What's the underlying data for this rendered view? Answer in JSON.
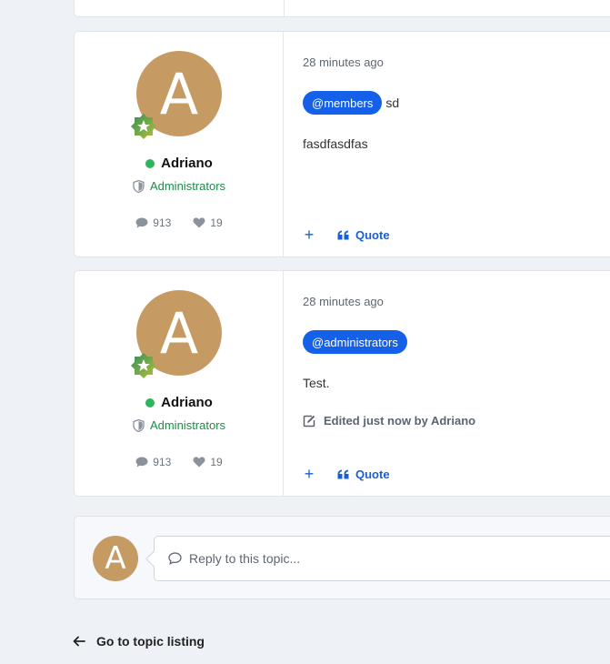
{
  "posts": [
    {
      "author": {
        "avatar_letter": "A",
        "name": "Adriano",
        "group": "Administrators",
        "post_count": "913",
        "reputation": "19"
      },
      "time": "28 minutes ago",
      "mention": "@members",
      "mention_trailing": "sd",
      "body": "fasdfasdfas",
      "quote_label": "Quote"
    },
    {
      "author": {
        "avatar_letter": "A",
        "name": "Adriano",
        "group": "Administrators",
        "post_count": "913",
        "reputation": "19"
      },
      "time": "28 minutes ago",
      "mention": "@administrators",
      "body": "Test.",
      "edited_text": "Edited just now by Adriano",
      "quote_label": "Quote"
    }
  ],
  "reply": {
    "avatar_letter": "A",
    "placeholder": "Reply to this topic..."
  },
  "back_link": "Go to topic listing",
  "colors": {
    "accent": "#1560e9",
    "online": "#2db55d",
    "group": "#1f8a4a",
    "avatar": "#c69a63",
    "page_bg": "#eef1f6"
  },
  "icons": [
    "star-badge-icon",
    "shield-icon",
    "comment-icon",
    "heart-icon",
    "plus-icon",
    "quote-icon",
    "edit-icon",
    "chat-bubble-icon",
    "arrow-left-icon"
  ]
}
